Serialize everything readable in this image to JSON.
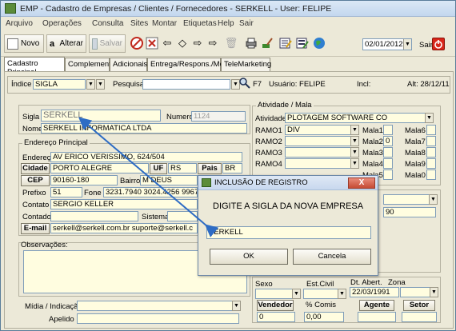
{
  "window": {
    "title": "EMP - Cadastro de Empresas / Clientes / Fornecedores - SERKELL - User: FELIPE"
  },
  "menu": [
    "Arquivo",
    "Operações",
    "Consulta",
    "Sites",
    "Montar",
    "Etiquetas",
    "Help",
    "Sair"
  ],
  "toolbar": {
    "novo": "Novo",
    "alterar": "Alterar",
    "salvar": "Salvar",
    "date": "02/01/2012",
    "sair": "Sair"
  },
  "tabs": [
    "Cadastro Principal",
    "Complemento",
    "Adicionais",
    "Entrega/Respons./Med",
    "TeleMarketing"
  ],
  "search": {
    "indice_label": "Índice",
    "indice_value": "SIGLA",
    "pesquisa_label": "Pesquisa",
    "f7": "F7",
    "usuario": "Usuário: FELIPE",
    "incl": "Incl:",
    "alt": "Alt: 28/12/11"
  },
  "main": {
    "sigla_label": "Sigla",
    "sigla_value": "SERKELL",
    "numero_label": "Numero",
    "numero_value": "1124",
    "nome_label": "Nome",
    "nome_value": "SERKELL INFORMATICA LTDA"
  },
  "endereco": {
    "group": "Endereço Principal",
    "endereco_label": "Endereço",
    "endereco_value": "AV ERICO VERISSIMO, 624/504",
    "cidade_label": "Cidade",
    "cidade_value": "PORTO ALEGRE",
    "uf_label": "UF",
    "uf_value": "RS",
    "pais_label": "Pais",
    "pais_value": "BR",
    "cep_label": "CEP",
    "cep_value": "90160-180",
    "bairro_label": "Bairro",
    "bairro_value": "M DEUS",
    "prefixo_label": "Prefixo",
    "prefixo_value": "51",
    "fone_label": "Fone",
    "fone_value": "3231.7940   3024.4256   9967.60",
    "contato_label": "Contato",
    "contato_value": "SERGIO KELLER",
    "contador_label": "Contador",
    "sistema_label": "Sistema",
    "email_label": "E-mail",
    "email_value": "serkell@serkell.com.br suporte@serkell.c"
  },
  "obs": {
    "label": "Observações:"
  },
  "midia": {
    "label": "Mídia / Indicação",
    "apelido_label": "Apelido"
  },
  "atividade": {
    "group": "Atividade / Mala",
    "atividade_label": "Atividade",
    "atividade_value": "PLOTAGEM SOFTWARE CO",
    "ramos": [
      {
        "label": "RAMO1",
        "value": "DIV"
      },
      {
        "label": "RAMO2",
        "value": ""
      },
      {
        "label": "RAMO3",
        "value": ""
      },
      {
        "label": "RAMO4",
        "value": ""
      }
    ],
    "malas_left": [
      {
        "label": "Mala1",
        "value": ""
      },
      {
        "label": "Mala2",
        "value": "0"
      },
      {
        "label": "Mala3",
        "value": ""
      },
      {
        "label": "Mala4",
        "value": ""
      },
      {
        "label": "Mala5",
        "value": ""
      }
    ],
    "malas_right": [
      {
        "label": "Mala6",
        "value": ""
      },
      {
        "label": "Mala7",
        "value": ""
      },
      {
        "label": "Mala8",
        "value": ""
      },
      {
        "label": "Mala9",
        "value": ""
      },
      {
        "label": "Mala0",
        "value": ""
      }
    ],
    "partial_val": "90"
  },
  "bottom": {
    "sexo_label": "Sexo",
    "estcivil_label": "Est.Civil",
    "dtabert_label": "Dt. Abert.",
    "dtabert_value": "22/03/1991",
    "zona_label": "Zona",
    "vendedor_label": "Vendedor",
    "vendedor_value": "0",
    "comis_label": "% Comis",
    "comis_value": "0,00",
    "agente_label": "Agente",
    "setor_label": "Setor"
  },
  "dialog": {
    "title": "INCLUSÃO DE REGISTRO",
    "message": "DIGITE A SIGLA DA NOVA EMPRESA",
    "input_value": "SERKELL",
    "ok": "OK",
    "cancel": "Cancela",
    "close": "X"
  },
  "colors": {
    "arrow": "#2e6cc4",
    "accent_red": "#c0281c",
    "yellow_field": "#fffde0"
  }
}
